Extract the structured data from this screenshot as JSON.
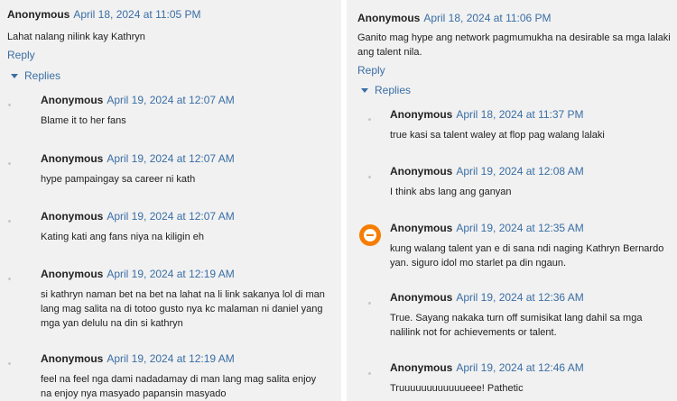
{
  "left": {
    "top": {
      "author": "Anonymous",
      "date": "April 18, 2024 at 11:05 PM",
      "text": "Lahat nalang nilink kay Kathryn",
      "reply": "Reply"
    },
    "replies_label": "Replies",
    "replies": [
      {
        "author": "Anonymous",
        "date": "April 19, 2024 at 12:07 AM",
        "text": "Blame it to her fans"
      },
      {
        "author": "Anonymous",
        "date": "April 19, 2024 at 12:07 AM",
        "text": "hype pampaingay sa career ni kath"
      },
      {
        "author": "Anonymous",
        "date": "April 19, 2024 at 12:07 AM",
        "text": "Kating kati ang fans niya na kiligin eh"
      },
      {
        "author": "Anonymous",
        "date": "April 19, 2024 at 12:19 AM",
        "text": "si kathryn naman bet na bet na lahat na li link sakanya lol di man lang mag salita na di totoo gusto nya kc malaman ni daniel yang mga yan delulu na din si kathryn"
      },
      {
        "author": "Anonymous",
        "date": "April 19, 2024 at 12:19 AM",
        "text": "feel na feel nga dami nadadamay di man lang mag salita enjoy na enjoy nya masyado papansin masyado"
      }
    ]
  },
  "right": {
    "top": {
      "author": "Anonymous",
      "date": "April 18, 2024 at 11:06 PM",
      "text": "Ganito mag hype ang network pagmumukha na desirable sa mga lalaki ang talent nila.",
      "reply": "Reply"
    },
    "replies_label": "Replies",
    "replies": [
      {
        "author": "Anonymous",
        "date": "April 18, 2024 at 11:37 PM",
        "text": "true kasi sa talent waley at flop pag walang lalaki"
      },
      {
        "author": "Anonymous",
        "date": "April 19, 2024 at 12:08 AM",
        "text": "I think abs lang ang ganyan"
      },
      {
        "author": "Anonymous",
        "date": "April 19, 2024 at 12:35 AM",
        "text": "kung walang talent yan e di sana ndi naging Kathryn Bernardo yan. siguro idol mo starlet pa din ngaun.",
        "avatar": "blogger-icon"
      },
      {
        "author": "Anonymous",
        "date": "April 19, 2024 at 12:36 AM",
        "text": "True. Sayang nakaka turn off sumisikat lang dahil sa mga nalilink not for achievements or talent."
      },
      {
        "author": "Anonymous",
        "date": "April 19, 2024 at 12:46 AM",
        "text": "Truuuuuuuuuuuueee! Pathetic"
      }
    ]
  },
  "colors": {
    "link": "#3a6ea5",
    "avatar": "#f57d00"
  }
}
